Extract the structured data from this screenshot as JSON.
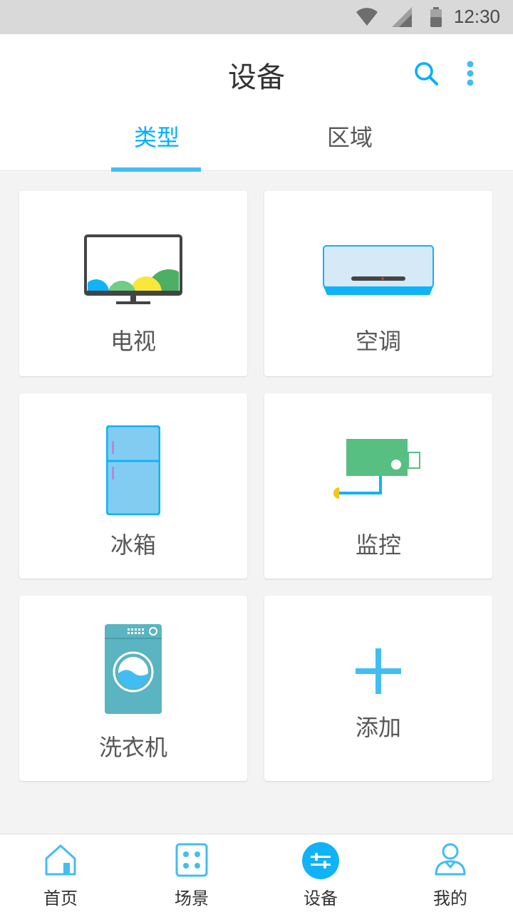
{
  "status_bar": {
    "time": "12:30"
  },
  "header": {
    "title": "设备",
    "search_icon": "search-icon",
    "more_icon": "more-vertical-icon",
    "tabs": [
      {
        "label": "类型",
        "active": true
      },
      {
        "label": "区域",
        "active": false
      }
    ]
  },
  "colors": {
    "accent": "#00AEFF",
    "indicator": "#42BDF4",
    "title": "#323232",
    "tab_inactive": "#575757"
  },
  "devices": [
    {
      "label": "电视",
      "icon": "tv-icon"
    },
    {
      "label": "空调",
      "icon": "air-conditioner-icon"
    },
    {
      "label": "冰箱",
      "icon": "fridge-icon"
    },
    {
      "label": "监控",
      "icon": "camera-icon"
    },
    {
      "label": "洗衣机",
      "icon": "washing-machine-icon"
    },
    {
      "label": "添加",
      "icon": "add-icon"
    }
  ],
  "bottom_nav": [
    {
      "label": "首页",
      "icon": "home-icon",
      "active": false
    },
    {
      "label": "场景",
      "icon": "scene-icon",
      "active": false
    },
    {
      "label": "设备",
      "icon": "device-settings-icon",
      "active": true
    },
    {
      "label": "我的",
      "icon": "profile-icon",
      "active": false
    }
  ]
}
